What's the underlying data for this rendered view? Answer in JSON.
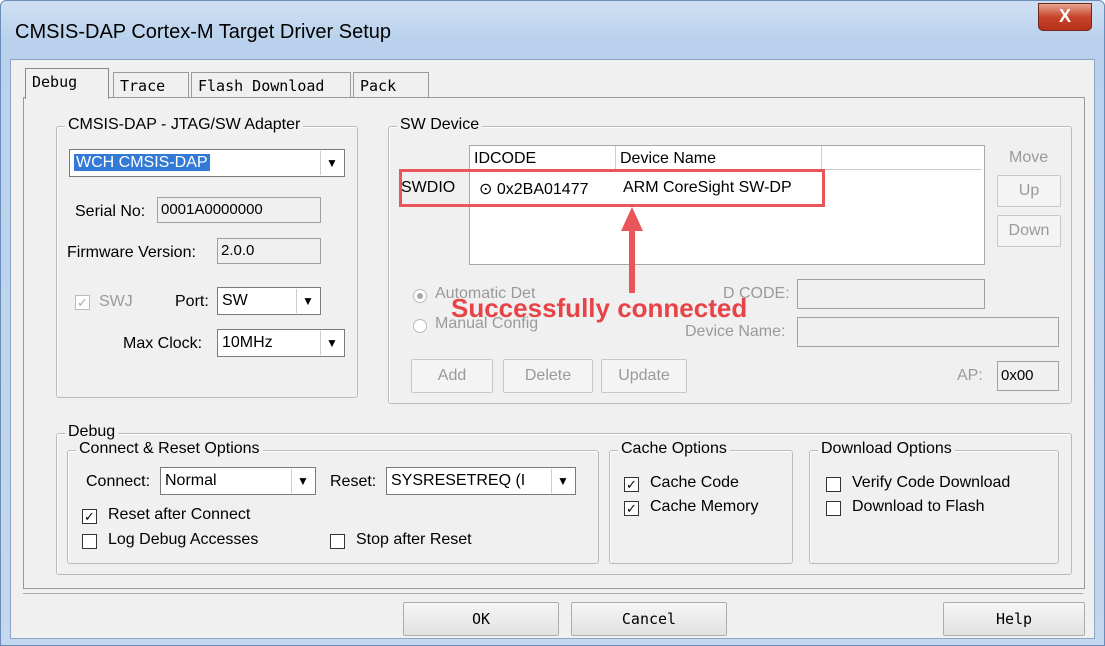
{
  "window": {
    "title": "CMSIS-DAP Cortex-M Target Driver Setup",
    "close_glyph": "X"
  },
  "tabs": [
    {
      "label": "Debug"
    },
    {
      "label": "Trace"
    },
    {
      "label": "Flash Download"
    },
    {
      "label": "Pack"
    }
  ],
  "adapter": {
    "legend": "CMSIS-DAP - JTAG/SW Adapter",
    "selected": "WCH CMSIS-DAP",
    "serial_label": "Serial No:",
    "serial_value": "0001A0000000",
    "firmware_label": "Firmware Version:",
    "firmware_value": "2.0.0",
    "swj_label": "SWJ",
    "port_label": "Port:",
    "port_value": "SW",
    "maxclock_label": "Max Clock:",
    "maxclock_value": "10MHz"
  },
  "sw_device": {
    "legend": "SW Device",
    "columns": [
      "IDCODE",
      "Device Name"
    ],
    "row": {
      "port": "SWDIO",
      "idcode": "0x2BA01477",
      "device": "ARM CoreSight SW-DP"
    },
    "move_label": "Move",
    "up_label": "Up",
    "down_label": "Down",
    "auto_detect_label": "Automatic Det",
    "manual_config_label": "Manual Config",
    "id_code_label": "D CODE:",
    "device_name_label": "Device Name:",
    "add_label": "Add",
    "delete_label": "Delete",
    "update_label": "Update",
    "ap_label": "AP:",
    "ap_value": "0x00",
    "annotation": "Successfully connected"
  },
  "debug": {
    "legend": "Debug",
    "connect_reset": {
      "legend": "Connect & Reset Options",
      "connect_label": "Connect:",
      "connect_value": "Normal",
      "reset_label": "Reset:",
      "reset_value": "SYSRESETREQ (I",
      "reset_after_connect": "Reset after Connect",
      "log_debug_accesses": "Log Debug Accesses",
      "stop_after_reset": "Stop after Reset"
    },
    "cache": {
      "legend": "Cache Options",
      "cache_code": "Cache Code",
      "cache_memory": "Cache Memory"
    },
    "download": {
      "legend": "Download Options",
      "verify": "Verify Code Download",
      "to_flash": "Download to Flash"
    }
  },
  "footer": {
    "ok": "OK",
    "cancel": "Cancel",
    "help": "Help"
  },
  "colors": {
    "annotation": "#e84447",
    "selection": "#3379d6"
  }
}
